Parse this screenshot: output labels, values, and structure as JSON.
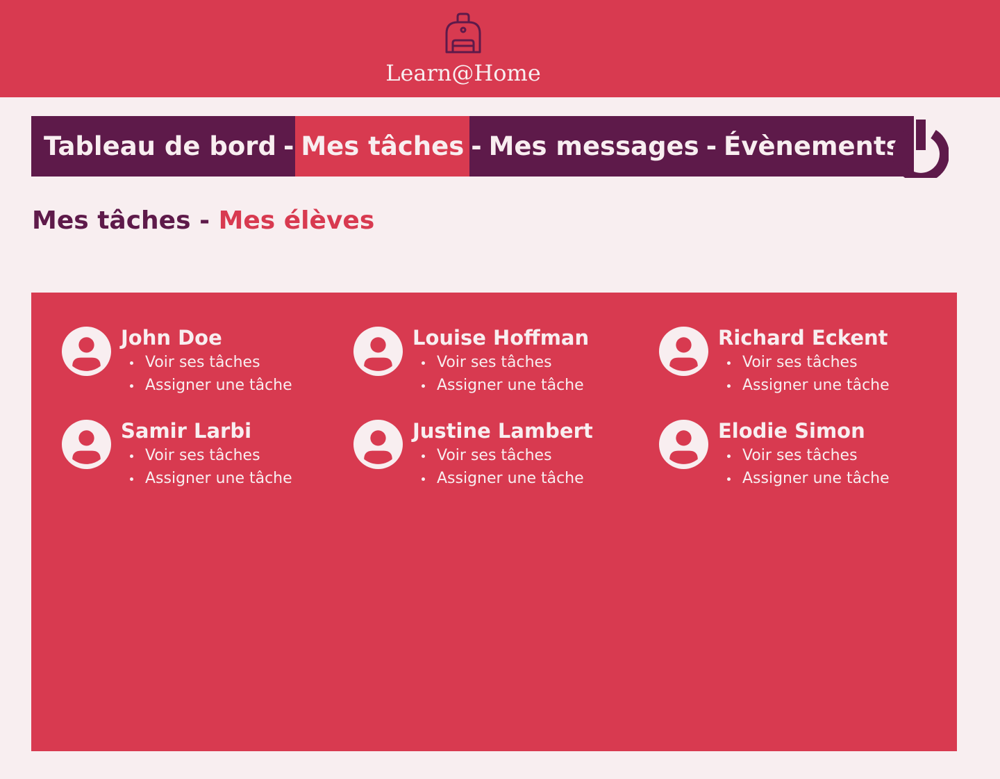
{
  "header": {
    "brand": "Learn@Home",
    "logo_icon": "backpack-icon",
    "background": "#d83a50"
  },
  "nav": {
    "items": [
      {
        "label": "Tableau de bord",
        "active": false
      },
      {
        "label": "Mes tâches",
        "active": true
      },
      {
        "label": "Mes messages",
        "active": false
      },
      {
        "label": "Évènements",
        "active": false
      }
    ],
    "separator": "-",
    "background": "#5e1a4a",
    "active_color": "#d83a50"
  },
  "power_button": {
    "icon": "power-icon"
  },
  "subnav": {
    "items": [
      {
        "label": "Mes tâches",
        "active": false
      },
      {
        "label": "Mes élèves",
        "active": true
      }
    ],
    "separator": "-"
  },
  "students": [
    {
      "name": "John Doe",
      "actions": [
        "Voir ses tâches",
        "Assigner une tâche"
      ]
    },
    {
      "name": "Louise Hoffman",
      "actions": [
        "Voir ses tâches",
        "Assigner une tâche"
      ]
    },
    {
      "name": "Richard Eckent",
      "actions": [
        "Voir ses tâches",
        "Assigner une tâche"
      ]
    },
    {
      "name": "Samir Larbi",
      "actions": [
        "Voir ses tâches",
        "Assigner une tâche"
      ]
    },
    {
      "name": "Justine Lambert",
      "actions": [
        "Voir ses tâches",
        "Assigner une tâche"
      ]
    },
    {
      "name": "Elodie Simon",
      "actions": [
        "Voir ses tâches",
        "Assigner une tâche"
      ]
    }
  ],
  "colors": {
    "primary": "#d83a50",
    "secondary": "#5e1a4a",
    "background": "#f8eef0"
  }
}
